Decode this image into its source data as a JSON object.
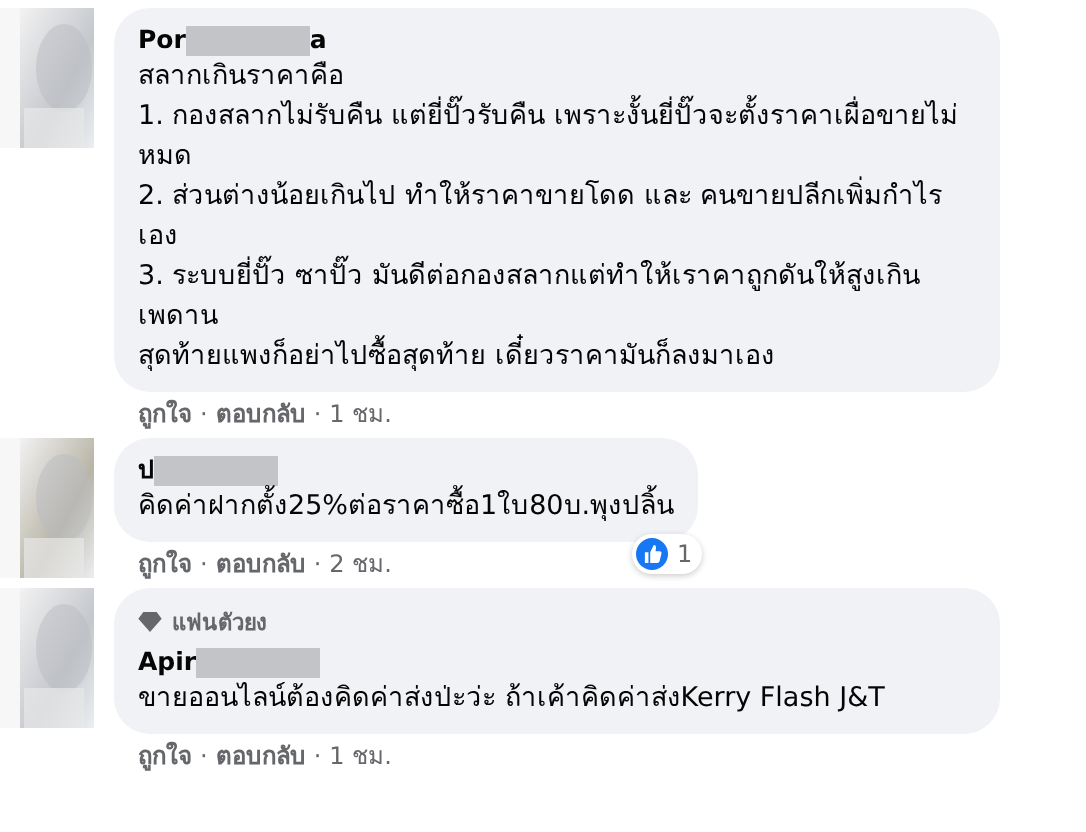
{
  "comments": [
    {
      "name_start": "Por",
      "name_end": "a",
      "paragraphs": [
        "สลากเกินราคาคือ",
        "1. กองสลากไม่รับคืน แต่ยี่ปั๊วรับคืน เพราะงั้นยี่ปั๊วจะตั้งราคาเผื่อขายไม่หมด",
        "2. ส่วนต่างน้อยเกินไป ทำให้ราคาขายโดด และ คนขายปลีกเพิ่มกำไรเอง",
        "3. ระบบยี่ปั๊ว ซาปั๊ว มันดีต่อกองสลากแต่ทำให้เราคาถูกดันให้สูงเกินเพดาน",
        "สุดท้ายแพงก็อย่าไปซื้อสุดท้าย เดี๋ยวราคามันก็ลงมาเอง"
      ],
      "like": "ถูกใจ",
      "sep_1": "·",
      "reply": "ตอบกลับ",
      "sep_2": "·",
      "time": "1 ชม."
    },
    {
      "name_start": "ป",
      "paragraphs": [
        "คิดค่าฝากตั้ง25%ต่อราคาซื้อ1ใบ80บ.พุงปลิ้น"
      ],
      "reactions": "1",
      "like": "ถูกใจ",
      "sep_1": "·",
      "reply": "ตอบกลับ",
      "sep_2": "·",
      "time": "2 ชม."
    },
    {
      "badge": "แฟนตัวยง",
      "name_start": "Apir",
      "paragraphs": [
        "ขายออนไลน์ต้องคิดค่าส่งป่ะว่ะ ถ้าเค้าคิดค่าส่งKerry Flash J&T"
      ],
      "like": "ถูกใจ",
      "sep_1": "·",
      "reply": "ตอบกลับ",
      "sep_2": "·",
      "time": "1 ชม."
    }
  ]
}
